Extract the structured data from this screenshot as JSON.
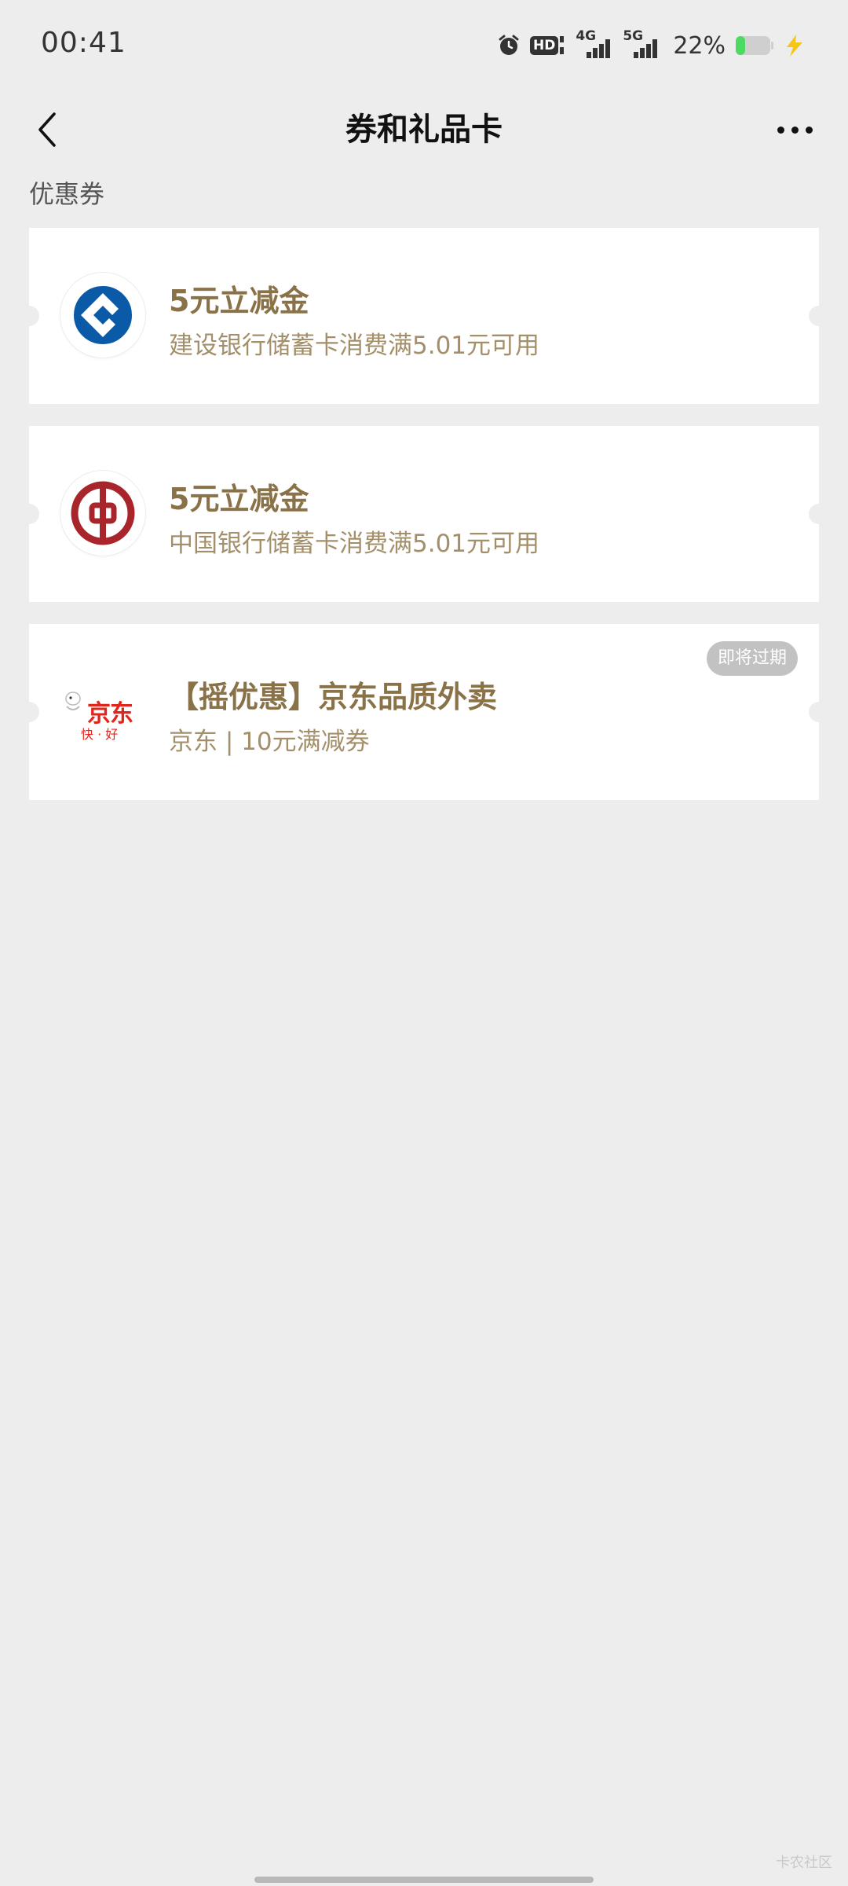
{
  "status_bar": {
    "time": "00:41",
    "hd_label": "HD",
    "network_4g": "4G",
    "network_5g": "5G",
    "battery_percent": "22%",
    "icons": [
      "alarm-icon",
      "hd-icon",
      "signal-4g-icon",
      "signal-5g-icon",
      "battery-icon",
      "charging-icon"
    ]
  },
  "nav": {
    "title": "券和礼品卡",
    "back_icon": "chevron-left-icon",
    "more_icon": "more-dots-icon"
  },
  "section": {
    "label": "优惠券"
  },
  "coupons": [
    {
      "logo": "ccb-logo",
      "title": "5元立减金",
      "description": "建设银行储蓄卡消费满5.01元可用",
      "badge": ""
    },
    {
      "logo": "boc-logo",
      "title": "5元立减金",
      "description": "中国银行储蓄卡消费满5.01元可用",
      "badge": ""
    },
    {
      "logo": "jd-logo",
      "logo_text_main": "京东",
      "logo_text_sub": "快 · 好",
      "title": "【摇优惠】京东品质外卖",
      "description": "京东 | 10元满减券",
      "badge": "即将过期"
    }
  ],
  "colors": {
    "background": "#ededed",
    "card": "#ffffff",
    "title_gold": "#8a7248",
    "desc_gold": "#a38f6a",
    "badge_gray": "#c2c2c2",
    "ccb_blue": "#0a5aa8",
    "boc_red": "#a8262b",
    "jd_red": "#e1251b",
    "battery_green": "#4cd964"
  },
  "watermark": "卡农社区"
}
